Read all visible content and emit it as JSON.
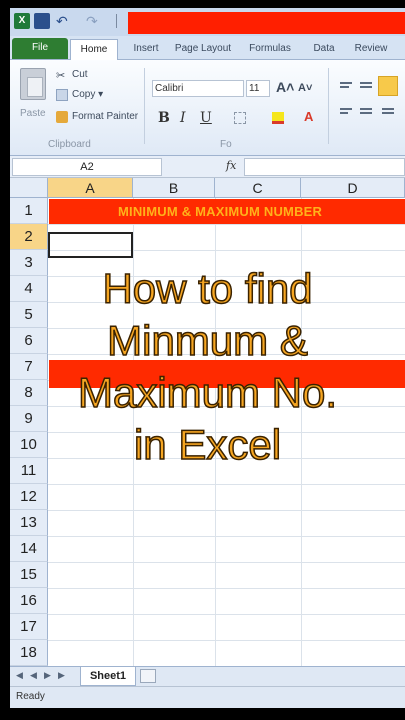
{
  "qat": {
    "logo": "X"
  },
  "tabs": [
    "File",
    "Home",
    "Insert",
    "Page Layout",
    "Formulas",
    "Data",
    "Review"
  ],
  "ribbon": {
    "paste_label": "Paste",
    "cut_label": "Cut",
    "copy_label": "Copy ▾",
    "format_painter_label": "Format Painter",
    "clipboard_group": "Clipboard",
    "font_name": "Calibri",
    "font_size": "11",
    "font_group": "Fo",
    "bold": "B",
    "italic": "I",
    "underline": "U"
  },
  "formula_bar": {
    "name_box": "A2",
    "fx": "fx",
    "value": ""
  },
  "grid": {
    "columns": [
      "A",
      "B",
      "C",
      "D"
    ],
    "selected_column": "A",
    "rows": [
      "1",
      "2",
      "3",
      "4",
      "5",
      "6",
      "7",
      "8",
      "9",
      "10",
      "11",
      "12",
      "13",
      "14",
      "15",
      "16",
      "17",
      "18"
    ],
    "selected_row": "2",
    "title_cell": "MINIMUM & MAXIMUM NUMBER",
    "colors": {
      "title_fill": "#ff2a00",
      "title_text": "#ffb21a",
      "overlay_text": "#f6a622"
    }
  },
  "overlay": {
    "lines": [
      "How to find",
      "Minmum &",
      "Maximum No.",
      "in Excel"
    ]
  },
  "sheets": {
    "active": "Sheet1"
  },
  "status": {
    "text": "Ready"
  }
}
